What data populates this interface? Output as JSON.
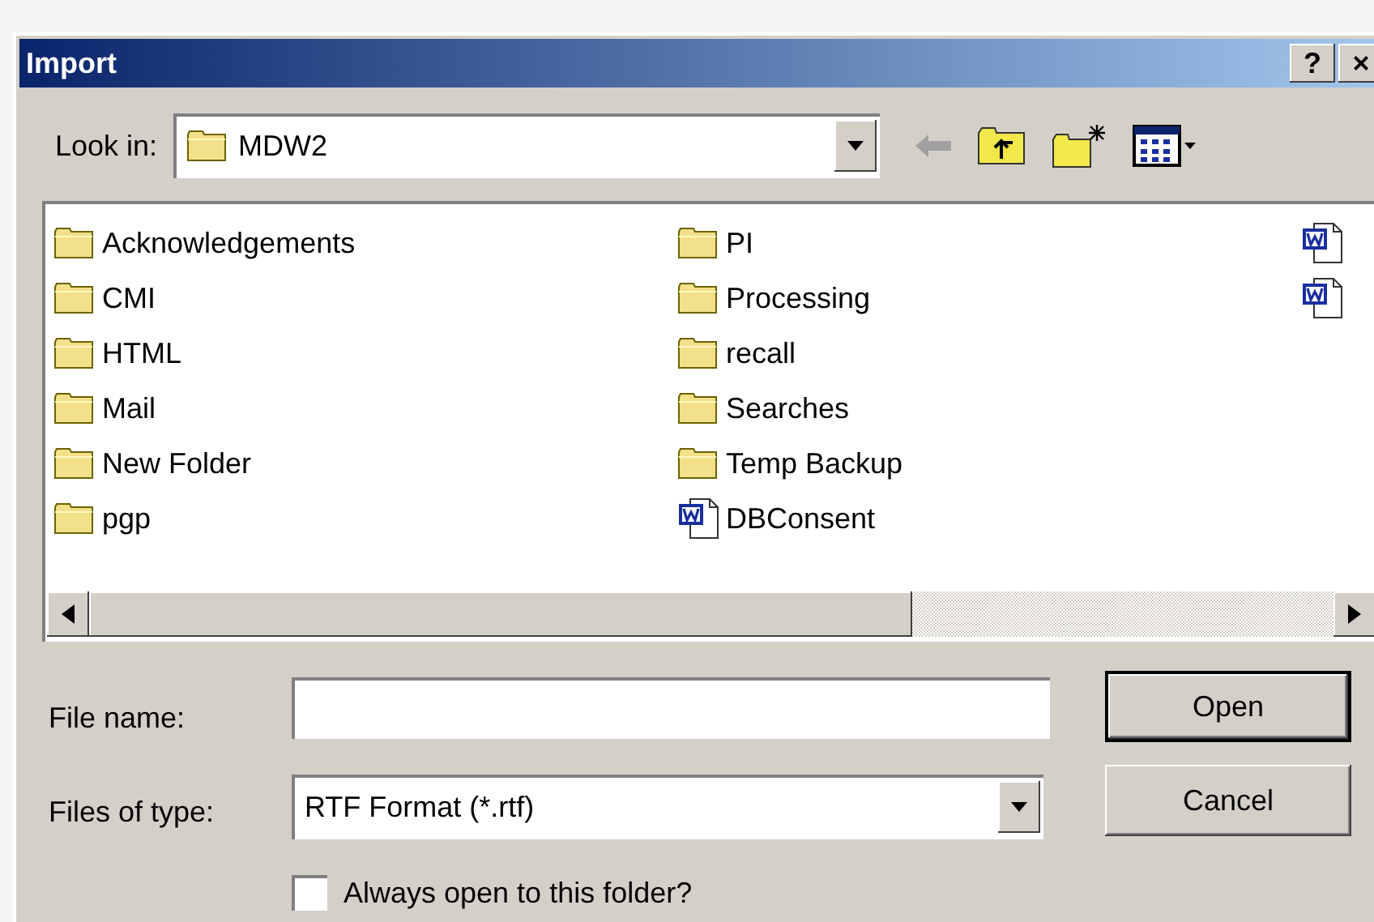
{
  "window": {
    "title": "Import",
    "title_buttons": [
      "?",
      "×"
    ]
  },
  "look_in": {
    "label": "Look in:",
    "value": "MDW2"
  },
  "files": [
    {
      "kind": "folder",
      "label": "Acknowledgements"
    },
    {
      "kind": "folder",
      "label": "CMI"
    },
    {
      "kind": "folder",
      "label": "HTML"
    },
    {
      "kind": "folder",
      "label": "Mail"
    },
    {
      "kind": "folder",
      "label": "New Folder"
    },
    {
      "kind": "folder",
      "label": "pgp"
    },
    {
      "kind": "folder",
      "label": "PI"
    },
    {
      "kind": "folder",
      "label": "Processing"
    },
    {
      "kind": "folder",
      "label": "recall"
    },
    {
      "kind": "folder",
      "label": "Searches"
    },
    {
      "kind": "folder",
      "label": "Temp Backup"
    },
    {
      "kind": "document",
      "label": "DBConsent"
    },
    {
      "kind": "document"
    },
    {
      "kind": "document"
    }
  ],
  "file_name": {
    "label": "File name:"
  },
  "file_type": {
    "label": "Files of type:",
    "value": "RTF Format (*.rtf)"
  },
  "always_open": {
    "label": "Always open to this folder?",
    "checked": false
  },
  "buttons": [
    {
      "label": "Open",
      "default": true
    },
    {
      "label": "Cancel",
      "default": false
    }
  ]
}
